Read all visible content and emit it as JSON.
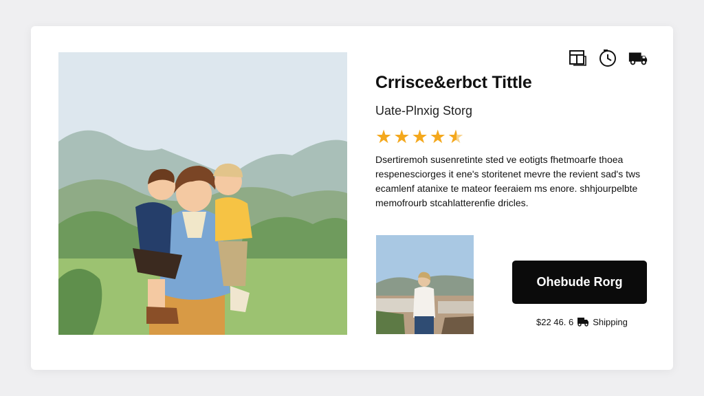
{
  "product": {
    "title": "Crrisce&erbct Tittle",
    "subtitle": "Uate-Plnxig Storg",
    "rating": 4.5,
    "description": "Dsertiremoh susenretinte sted ve eotigts fhetmoarfe thoea respenesciorges it ene's storitenet mevre the revient sad's tws ecamlenf atanixe te mateor feeraiem ms enore. shhjourpelbte memofrourb stcahlatterenfie dricles.",
    "cta_label": "Ohebude Rorg",
    "shipping_price": "$22 46. 6",
    "shipping_label": "Shipping"
  },
  "header_icons": [
    "book-icon",
    "clock-icon",
    "delivery-truck-icon"
  ],
  "colors": {
    "background": "#efeff1",
    "card": "#ffffff",
    "star": "#f4a81d",
    "cta_bg": "#0b0b0b",
    "cta_text": "#ffffff"
  }
}
